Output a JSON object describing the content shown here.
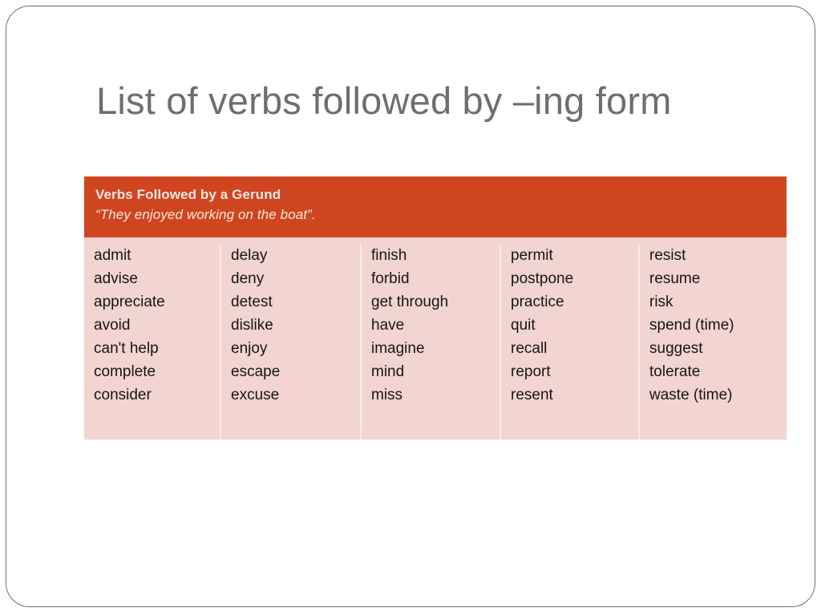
{
  "slide": {
    "title": "List of verbs followed by –ing form",
    "accent_color": "#cf4520",
    "body_color": "#f2d4d0",
    "title_color": "#6e6e6e"
  },
  "table": {
    "header_title": "Verbs Followed by a Gerund",
    "header_example": "“They enjoyed working on the boat”.",
    "columns": [
      {
        "items": [
          "admit",
          "advise",
          "appreciate",
          "avoid",
          "can't help",
          "complete",
          "consider"
        ]
      },
      {
        "items": [
          "delay",
          "deny",
          "detest",
          "dislike",
          "enjoy",
          "escape",
          "excuse"
        ]
      },
      {
        "items": [
          "finish",
          "forbid",
          "get through",
          "have",
          "imagine",
          "mind",
          "miss"
        ]
      },
      {
        "items": [
          "permit",
          "postpone",
          "practice",
          "quit",
          "recall",
          "report",
          "resent"
        ]
      },
      {
        "items": [
          "resist",
          "resume",
          "risk",
          "spend (time)",
          "suggest",
          "tolerate",
          "waste (time)"
        ]
      }
    ]
  }
}
